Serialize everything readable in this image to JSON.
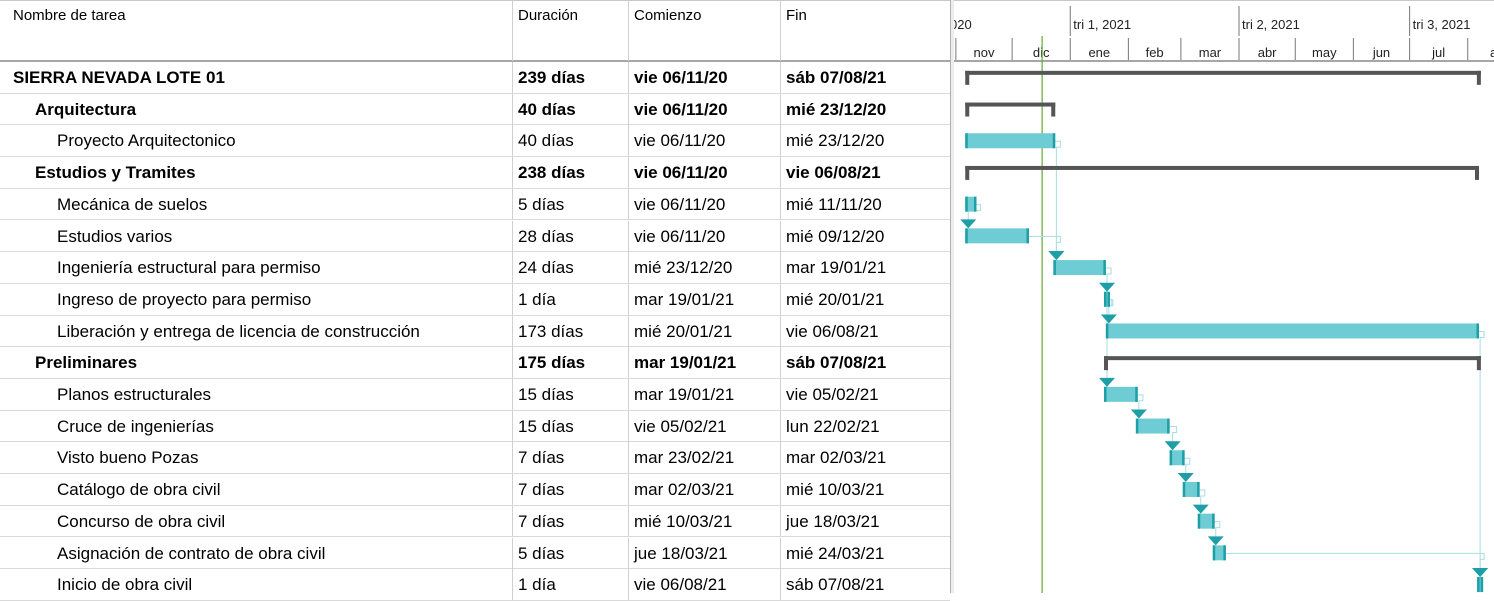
{
  "columns": {
    "name": "Nombre de tarea",
    "duration": "Duración",
    "start": "Comienzo",
    "finish": "Fin"
  },
  "timescale": {
    "quarters": [
      {
        "label": "020",
        "date": "2020-10-01"
      },
      {
        "label": "tri 1, 2021",
        "date": "2021-01-01"
      },
      {
        "label": "tri 2, 2021",
        "date": "2021-04-01"
      },
      {
        "label": "tri 3, 2021",
        "date": "2021-07-01"
      }
    ],
    "months": [
      {
        "label": "nov",
        "date": "2020-11-01"
      },
      {
        "label": "dic",
        "date": "2020-12-01"
      },
      {
        "label": "ene",
        "date": "2021-01-01"
      },
      {
        "label": "feb",
        "date": "2021-02-01"
      },
      {
        "label": "mar",
        "date": "2021-03-01"
      },
      {
        "label": "abr",
        "date": "2021-04-01"
      },
      {
        "label": "may",
        "date": "2021-05-01"
      },
      {
        "label": "jun",
        "date": "2021-06-01"
      },
      {
        "label": "jul",
        "date": "2021-07-01"
      },
      {
        "label": "ago",
        "date": "2021-08-01"
      }
    ],
    "status_date": "2020-12-01",
    "range": [
      "2020-10-31",
      "2021-08-15"
    ]
  },
  "colors": {
    "task_bar": "#6ecdd4",
    "task_bar_edge": "#1e9fa8",
    "summary_bar": "#555555",
    "link_line": "#a8dde0",
    "status_line": "#70ad47"
  },
  "chart_data": {
    "type": "gantt",
    "tasks": [
      {
        "name": "SIERRA NEVADA LOTE 01",
        "duration": "239 días",
        "start": "vie 06/11/20",
        "finish": "sáb 07/08/21",
        "level": 0,
        "summary": true,
        "start_date": "2020-11-06",
        "end_date": "2021-08-07"
      },
      {
        "name": "Arquitectura",
        "duration": "40 días",
        "start": "vie 06/11/20",
        "finish": "mié 23/12/20",
        "level": 1,
        "summary": true,
        "start_date": "2020-11-06",
        "end_date": "2020-12-23"
      },
      {
        "name": "Proyecto Arquitectonico",
        "duration": "40 días",
        "start": "vie 06/11/20",
        "finish": "mié 23/12/20",
        "level": 2,
        "summary": false,
        "start_date": "2020-11-06",
        "end_date": "2020-12-23"
      },
      {
        "name": "Estudios y Tramites",
        "duration": "238 días",
        "start": "vie 06/11/20",
        "finish": "vie 06/08/21",
        "level": 1,
        "summary": true,
        "start_date": "2020-11-06",
        "end_date": "2021-08-06"
      },
      {
        "name": "Mecánica de suelos",
        "duration": "5 días",
        "start": "vie 06/11/20",
        "finish": "mié 11/11/20",
        "level": 2,
        "summary": false,
        "start_date": "2020-11-06",
        "end_date": "2020-11-11"
      },
      {
        "name": "Estudios varios",
        "duration": "28 días",
        "start": "vie 06/11/20",
        "finish": "mié 09/12/20",
        "level": 2,
        "summary": false,
        "start_date": "2020-11-06",
        "end_date": "2020-12-09"
      },
      {
        "name": "Ingeniería estructural para permiso",
        "duration": "24 días",
        "start": "mié 23/12/20",
        "finish": "mar 19/01/21",
        "level": 2,
        "summary": false,
        "start_date": "2020-12-23",
        "end_date": "2021-01-19"
      },
      {
        "name": "Ingreso de proyecto para permiso",
        "duration": "1 día",
        "start": "mar 19/01/21",
        "finish": "mié 20/01/21",
        "level": 2,
        "summary": false,
        "start_date": "2021-01-19",
        "end_date": "2021-01-20"
      },
      {
        "name": "Liberación y entrega de licencia de construcción",
        "duration": "173 días",
        "start": "mié 20/01/21",
        "finish": "vie 06/08/21",
        "level": 2,
        "summary": false,
        "start_date": "2021-01-20",
        "end_date": "2021-08-06"
      },
      {
        "name": "Preliminares",
        "duration": "175 días",
        "start": "mar 19/01/21",
        "finish": "sáb 07/08/21",
        "level": 1,
        "summary": true,
        "start_date": "2021-01-19",
        "end_date": "2021-08-07"
      },
      {
        "name": "Planos estructurales",
        "duration": "15 días",
        "start": "mar 19/01/21",
        "finish": "vie 05/02/21",
        "level": 2,
        "summary": false,
        "start_date": "2021-01-19",
        "end_date": "2021-02-05"
      },
      {
        "name": "Cruce de ingenierías",
        "duration": "15 días",
        "start": "vie 05/02/21",
        "finish": "lun 22/02/21",
        "level": 2,
        "summary": false,
        "start_date": "2021-02-05",
        "end_date": "2021-02-22"
      },
      {
        "name": "Visto bueno Pozas",
        "duration": "7 días",
        "start": "mar 23/02/21",
        "finish": "mar 02/03/21",
        "level": 2,
        "summary": false,
        "start_date": "2021-02-23",
        "end_date": "2021-03-02"
      },
      {
        "name": "Catálogo de obra civil",
        "duration": "7 días",
        "start": "mar 02/03/21",
        "finish": "mié 10/03/21",
        "level": 2,
        "summary": false,
        "start_date": "2021-03-02",
        "end_date": "2021-03-10"
      },
      {
        "name": "Concurso de obra civil",
        "duration": "7 días",
        "start": "mié 10/03/21",
        "finish": "jue 18/03/21",
        "level": 2,
        "summary": false,
        "start_date": "2021-03-10",
        "end_date": "2021-03-18"
      },
      {
        "name": "Asignación de contrato de obra civil",
        "duration": "5 días",
        "start": "jue 18/03/21",
        "finish": "mié 24/03/21",
        "level": 2,
        "summary": false,
        "start_date": "2021-03-18",
        "end_date": "2021-03-24"
      },
      {
        "name": "Inicio de obra civil",
        "duration": "1 día",
        "start": "vie 06/08/21",
        "finish": "sáb 07/08/21",
        "level": 2,
        "summary": false,
        "start_date": "2021-08-06",
        "end_date": "2021-08-07"
      }
    ],
    "links": [
      [
        2,
        6
      ],
      [
        4,
        5
      ],
      [
        5,
        6
      ],
      [
        6,
        7
      ],
      [
        7,
        8
      ],
      [
        8,
        16
      ],
      [
        7,
        10
      ],
      [
        10,
        11
      ],
      [
        11,
        12
      ],
      [
        12,
        13
      ],
      [
        13,
        14
      ],
      [
        14,
        15
      ],
      [
        15,
        16
      ]
    ]
  }
}
